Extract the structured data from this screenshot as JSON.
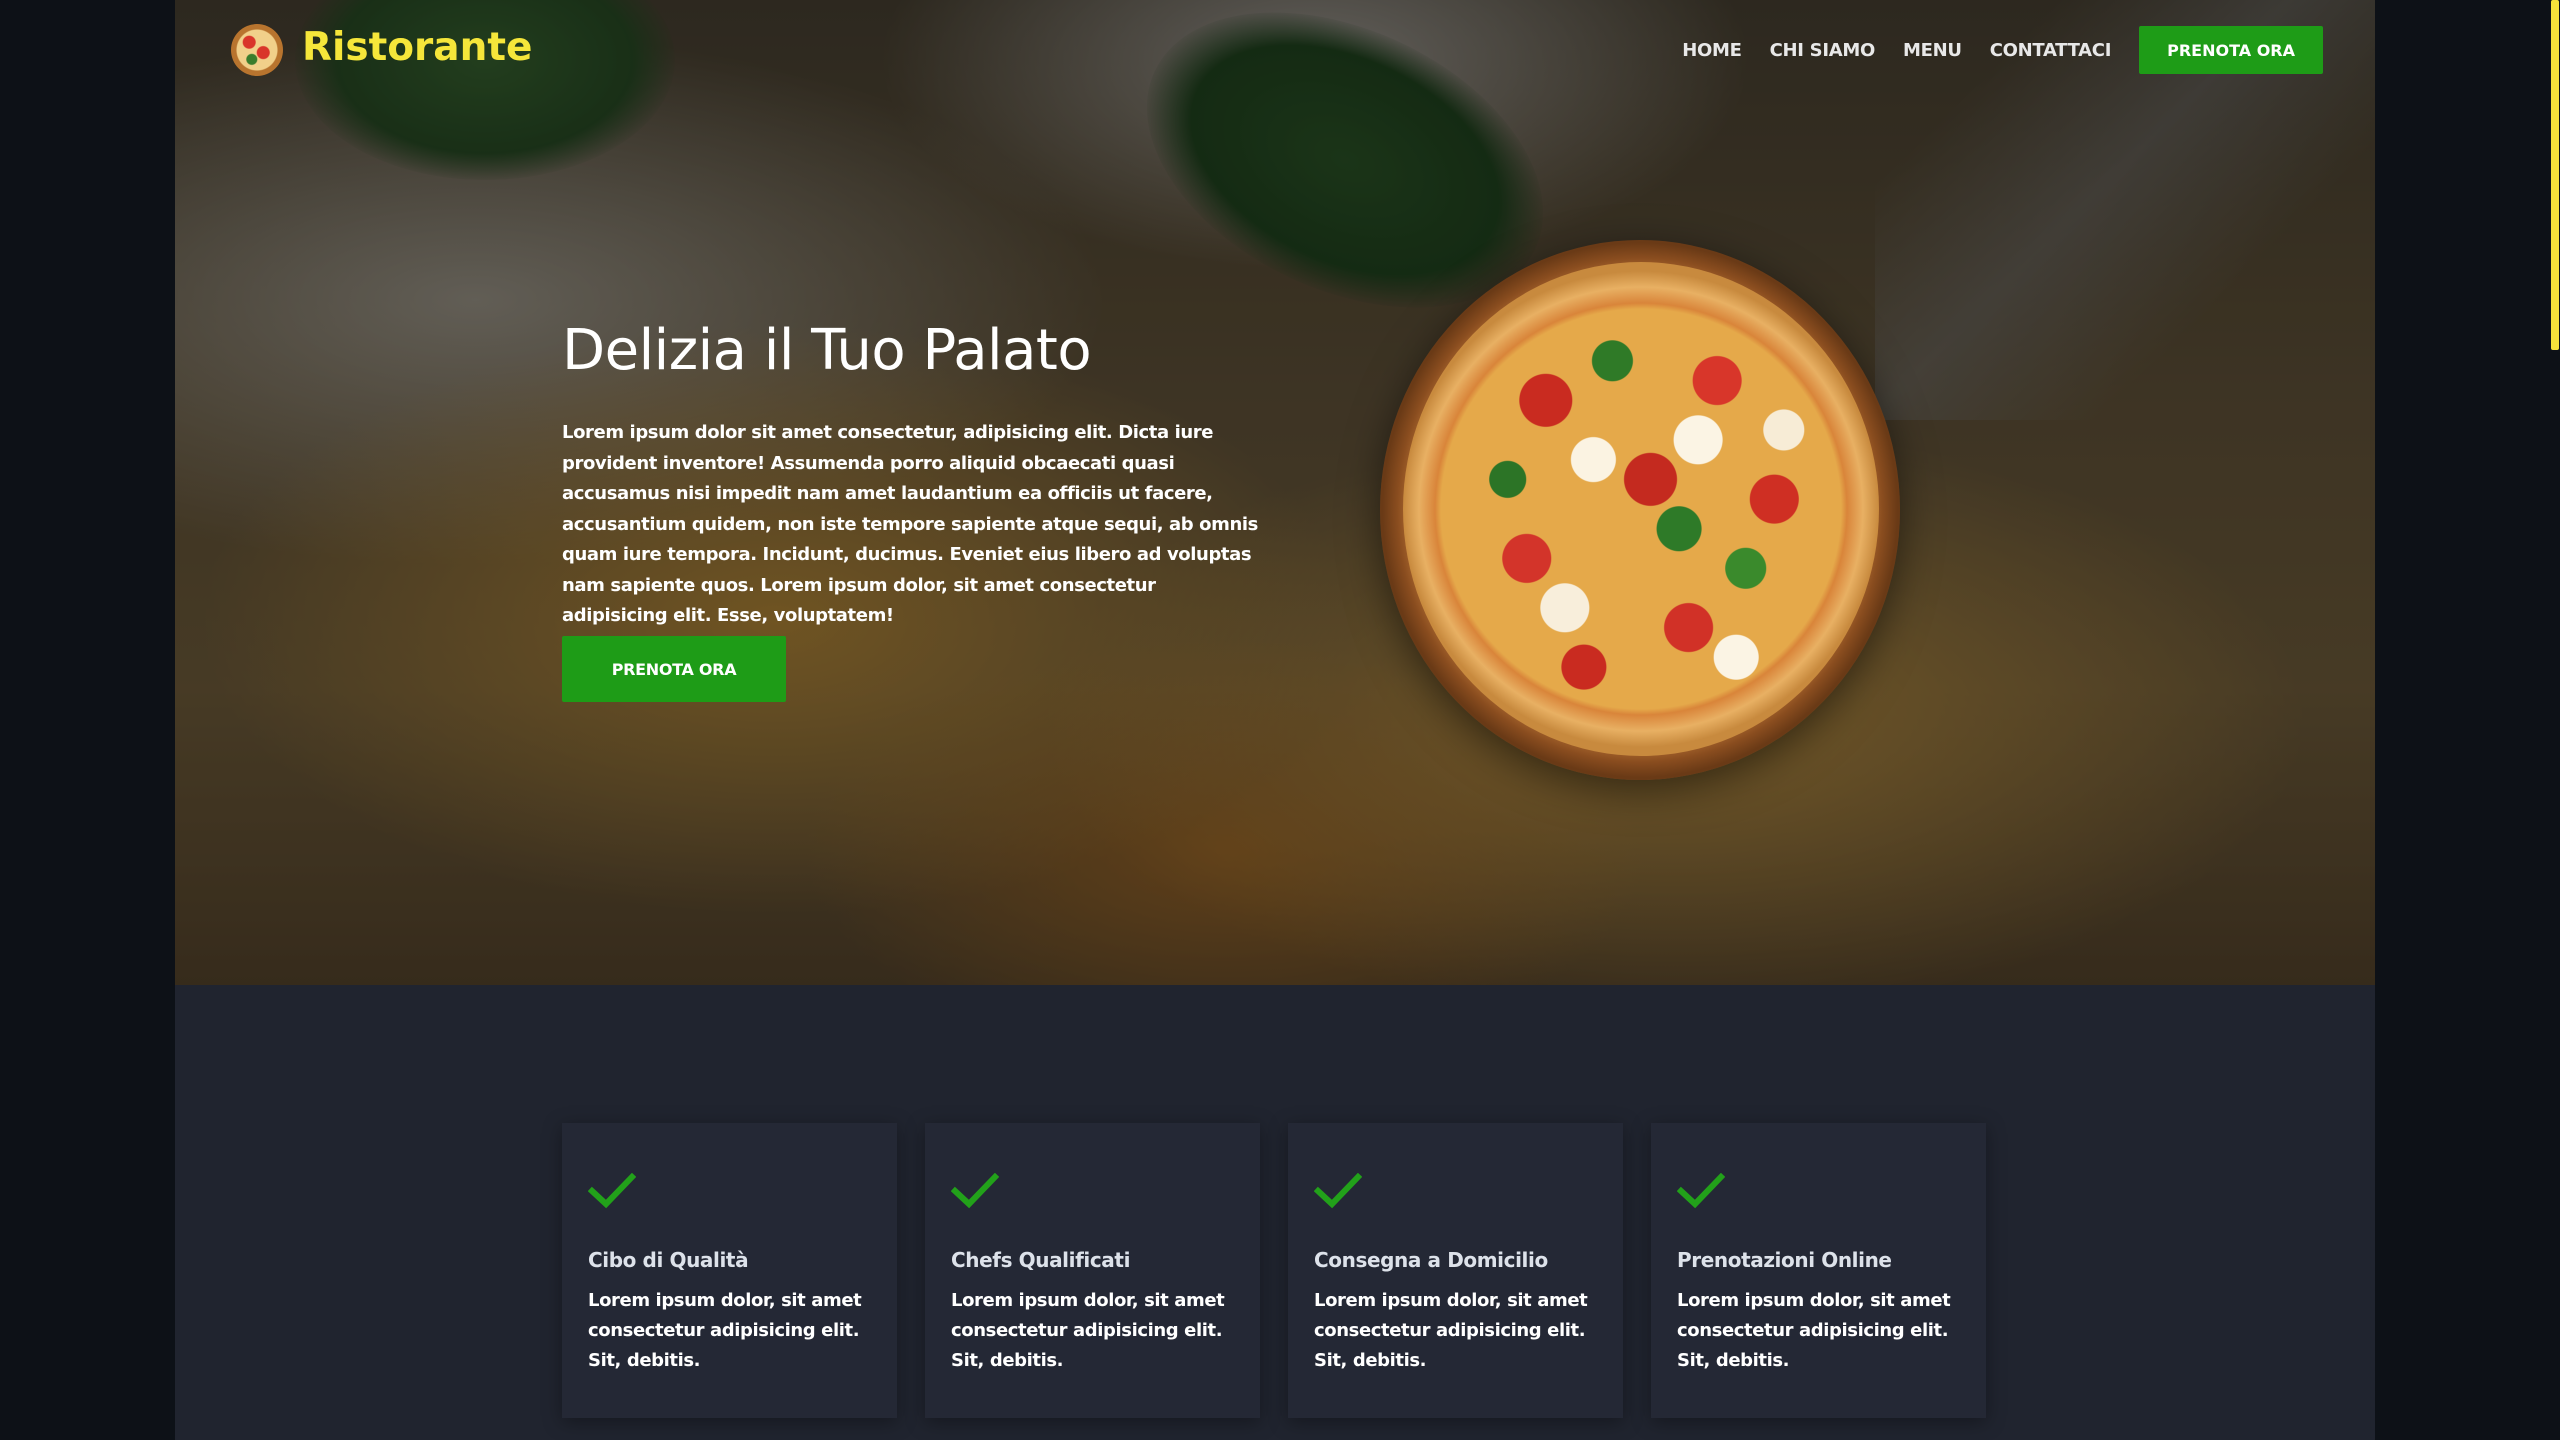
{
  "brand": {
    "name": "Ristorante",
    "logo_icon": "pizza-icon",
    "color": "#f5e63a"
  },
  "nav": {
    "items": [
      {
        "label": "HOME"
      },
      {
        "label": "CHI SIAMO"
      },
      {
        "label": "MENU"
      },
      {
        "label": "CONTATTACI"
      }
    ],
    "cta_label": "PRENOTA ORA"
  },
  "hero": {
    "title": "Delizia il Tuo Palato",
    "text": "Lorem ipsum dolor sit amet consectetur, adipisicing elit. Dicta iure provident inventore! Assumenda porro aliquid obcaecati quasi accusamus nisi impedit nam amet laudantium ea officiis ut facere, accusantium quidem, non iste tempore sapiente atque sequi, ab omnis quam iure tempora. Incidunt, ducimus. Eveniet eius libero ad voluptas nam sapiente quos. Lorem ipsum dolor, sit amet consectetur adipisicing elit. Esse, voluptatem!",
    "cta_label": "PRENOTA ORA",
    "image": "pizza-on-board"
  },
  "features": [
    {
      "icon": "check-icon",
      "title": "Cibo di Qualità",
      "text": "Lorem ipsum dolor, sit amet consectetur adipisicing elit. Sit, debitis."
    },
    {
      "icon": "check-icon",
      "title": "Chefs Qualificati",
      "text": "Lorem ipsum dolor, sit amet consectetur adipisicing elit. Sit, debitis."
    },
    {
      "icon": "check-icon",
      "title": "Consegna a Domicilio",
      "text": "Lorem ipsum dolor, sit amet consectetur adipisicing elit. Sit, debitis."
    },
    {
      "icon": "check-icon",
      "title": "Prenotazioni Online",
      "text": "Lorem ipsum dolor, sit amet consectetur adipisicing elit. Sit, debitis."
    }
  ],
  "colors": {
    "accent": "#1e9c17",
    "brand_yellow": "#f5e63a",
    "page_bg": "#20242f",
    "card_bg": "#242835",
    "check": "#22a11a"
  }
}
